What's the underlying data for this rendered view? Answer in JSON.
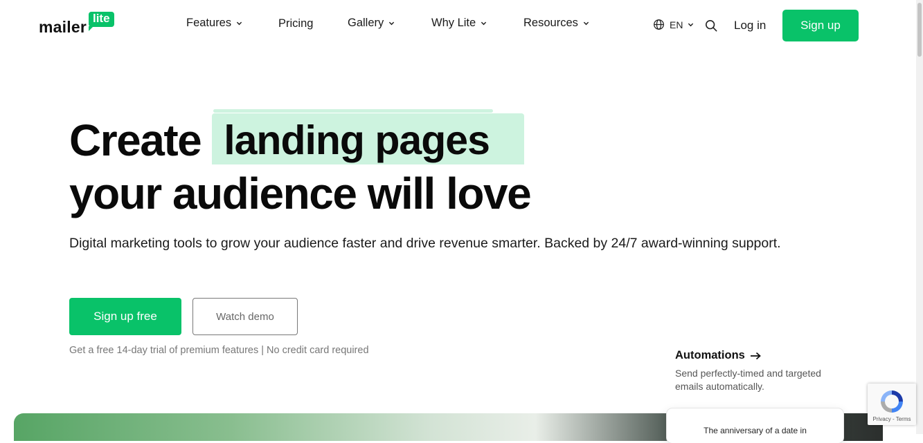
{
  "header": {
    "logo_word": "mailer",
    "logo_badge": "lite",
    "nav": [
      {
        "label": "Features",
        "has_dropdown": true
      },
      {
        "label": "Pricing",
        "has_dropdown": false
      },
      {
        "label": "Gallery",
        "has_dropdown": true
      },
      {
        "label": "Why Lite",
        "has_dropdown": true
      },
      {
        "label": "Resources",
        "has_dropdown": true
      }
    ],
    "language": "EN",
    "login": "Log in",
    "signup": "Sign up"
  },
  "hero": {
    "title_word": "Create",
    "title_highlight": "landing pages",
    "title_line2": "your audience will love",
    "subtitle": "Digital marketing tools to grow your audience faster and drive revenue smarter. Backed by 24/7 award-winning support.",
    "cta_primary": "Sign up free",
    "cta_secondary": "Watch demo",
    "note": "Get a free 14-day trial of premium features | No credit card required"
  },
  "automations": {
    "title": "Automations",
    "description": "Send perfectly-timed and targeted emails automatically.",
    "card_text": "The anniversary of a date in"
  },
  "recaptcha": {
    "text": "Privacy - Terms"
  },
  "colors": {
    "brand_green": "#09c269",
    "highlight": "#cdf3df"
  }
}
